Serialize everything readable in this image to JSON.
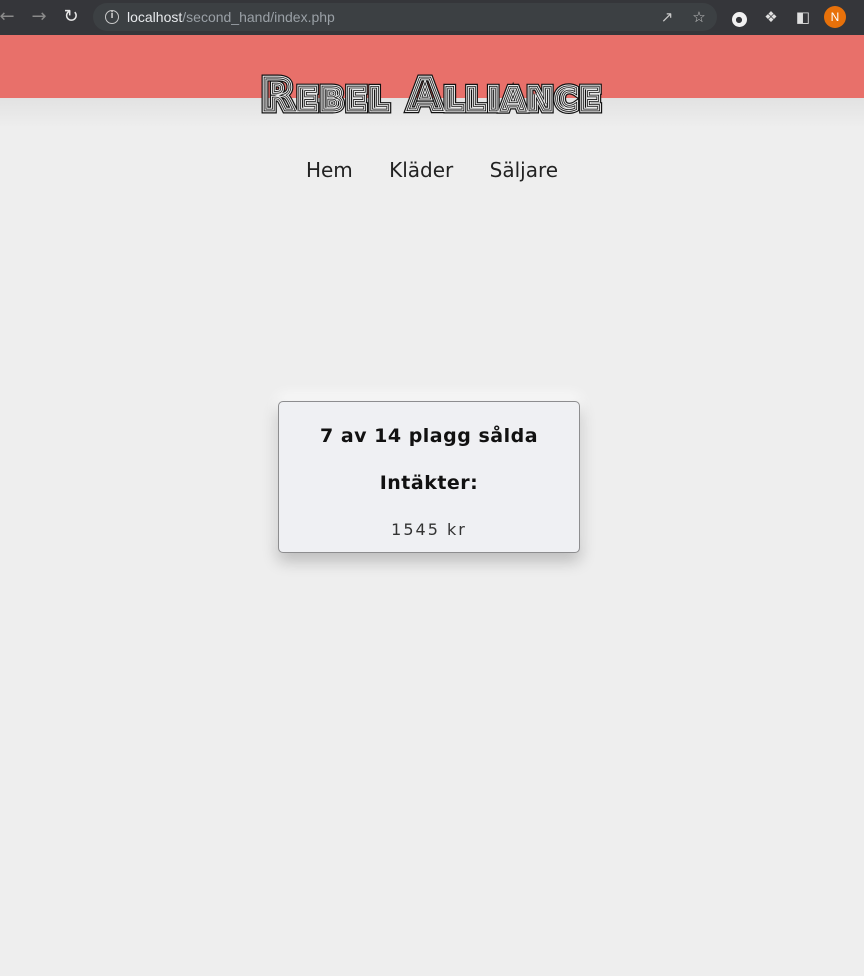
{
  "browser": {
    "url_host": "localhost",
    "url_path": "/second_hand/index.php",
    "profile_initial": "N"
  },
  "site": {
    "logo_text": "Rebel Alliance",
    "nav": [
      "Hem",
      "Kläder",
      "Säljare"
    ]
  },
  "stats": {
    "sold_text": "7 av 14 plagg sålda",
    "revenue_label": "Intäkter:",
    "revenue_value": "1545 kr"
  },
  "colors": {
    "banner": "#e8706a",
    "page_bg": "#eeeeee",
    "card_bg": "#eff0f3"
  }
}
